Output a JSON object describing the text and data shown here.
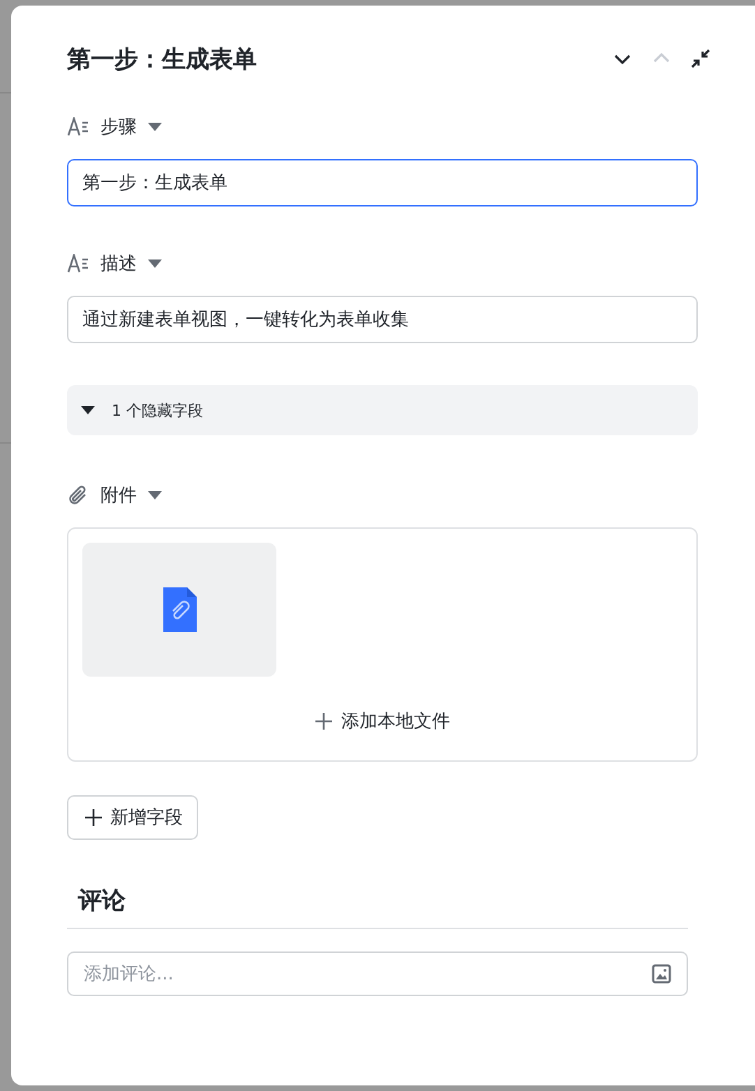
{
  "header": {
    "title": "第一步：生成表单",
    "next_disabled": false,
    "prev_disabled": true
  },
  "fields": [
    {
      "kind": "text",
      "label": "步骤",
      "value": "第一步：生成表单",
      "focused": true
    },
    {
      "kind": "text",
      "label": "描述",
      "value": "通过新建表单视图，一键转化为表单收集",
      "focused": false
    },
    {
      "kind": "expander",
      "label": "1 个隐藏字段",
      "expanded": false
    },
    {
      "kind": "attachment",
      "label": "附件",
      "files": [
        {
          "kind": "file"
        }
      ],
      "add_label": "添加本地文件"
    }
  ],
  "add_field_button": "新增字段",
  "comments": {
    "title": "评论",
    "placeholder": "添加评论..."
  }
}
